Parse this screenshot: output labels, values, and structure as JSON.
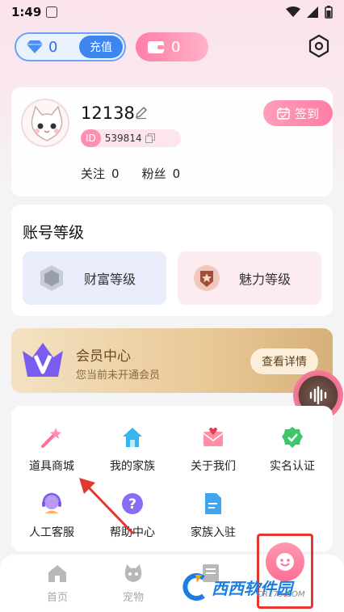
{
  "status": {
    "time": "1:49"
  },
  "header": {
    "diamond_count": "0",
    "recharge_label": "充值",
    "wallet_count": "0"
  },
  "profile": {
    "username": "12138",
    "id_badge": "ID",
    "id_value": "539814",
    "checkin_label": "签到",
    "follow_label": "关注",
    "follow_count": "0",
    "fans_label": "粉丝",
    "fans_count": "0"
  },
  "level": {
    "title": "账号等级",
    "wealth_label": "财富等级",
    "charm_label": "魅力等级"
  },
  "vip": {
    "title": "会员中心",
    "subtitle": "您当前未开通会员",
    "button_label": "查看详情"
  },
  "menu": {
    "items": [
      {
        "label": "道具商城",
        "icon": "magic-wand-icon"
      },
      {
        "label": "我的家族",
        "icon": "home-icon"
      },
      {
        "label": "关于我们",
        "icon": "mail-heart-icon"
      },
      {
        "label": "实名认证",
        "icon": "verified-icon"
      },
      {
        "label": "人工客服",
        "icon": "customer-service-icon"
      },
      {
        "label": "帮助中心",
        "icon": "help-icon"
      },
      {
        "label": "家族入驻",
        "icon": "document-icon"
      }
    ]
  },
  "nav": {
    "items": [
      {
        "label": "首页",
        "icon": "home-icon"
      },
      {
        "label": "宠物",
        "icon": "pet-icon"
      }
    ]
  },
  "watermark": {
    "text": "西西软件园",
    "sub": "CR173.COM"
  },
  "colors": {
    "accent_pink": "#ff7ea4",
    "accent_blue": "#3d86f0",
    "vip_gold": "#e9c997",
    "annotation_red": "#e2382e"
  }
}
